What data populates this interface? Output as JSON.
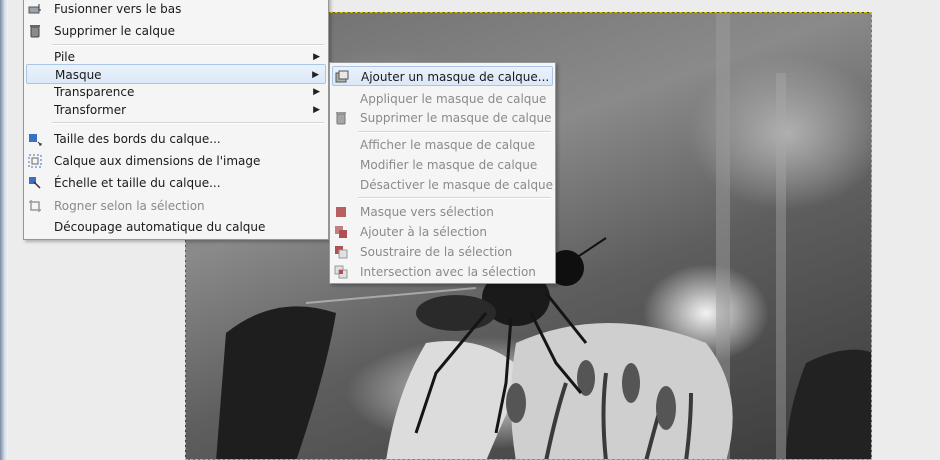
{
  "main_menu": {
    "items": [
      {
        "label": "Fusionner vers le bas",
        "icon": "merge-down-icon"
      },
      {
        "label": "Supprimer le calque",
        "icon": "trash-icon"
      },
      {
        "label": "Pile",
        "icon": ""
      },
      {
        "label": "Masque",
        "icon": ""
      },
      {
        "label": "Transparence",
        "icon": ""
      },
      {
        "label": "Transformer",
        "icon": ""
      },
      {
        "label": "Taille des bords du calque...",
        "icon": "layer-boundary-icon"
      },
      {
        "label": "Calque aux dimensions de l'image",
        "icon": "layer-to-image-size-icon"
      },
      {
        "label": "Échelle et taille du calque...",
        "icon": "scale-layer-icon"
      },
      {
        "label": "Rogner selon la sélection",
        "icon": "crop-icon"
      },
      {
        "label": "Découpage automatique du calque",
        "icon": ""
      }
    ]
  },
  "mask_submenu": {
    "items": [
      {
        "label": "Ajouter un masque de calque...",
        "icon": "add-layer-mask-icon"
      },
      {
        "label": "Appliquer le masque de calque",
        "icon": ""
      },
      {
        "label": "Supprimer le masque de calque",
        "icon": "trash-icon"
      },
      {
        "label": "Afficher le masque de calque",
        "icon": ""
      },
      {
        "label": "Modifier le masque de calque",
        "icon": ""
      },
      {
        "label": "Désactiver le masque de calque",
        "icon": ""
      },
      {
        "label": "Masque vers sélection",
        "icon": "mask-to-selection-icon"
      },
      {
        "label": "Ajouter à la sélection",
        "icon": "selection-add-icon"
      },
      {
        "label": "Soustraire de la sélection",
        "icon": "selection-subtract-icon"
      },
      {
        "label": "Intersection avec la sélection",
        "icon": "selection-intersect-icon"
      }
    ]
  },
  "colors": {
    "highlight_border": "#a9c6e8",
    "selection_marching_ants": "#d4c200",
    "mask_icon": "#b05050"
  }
}
